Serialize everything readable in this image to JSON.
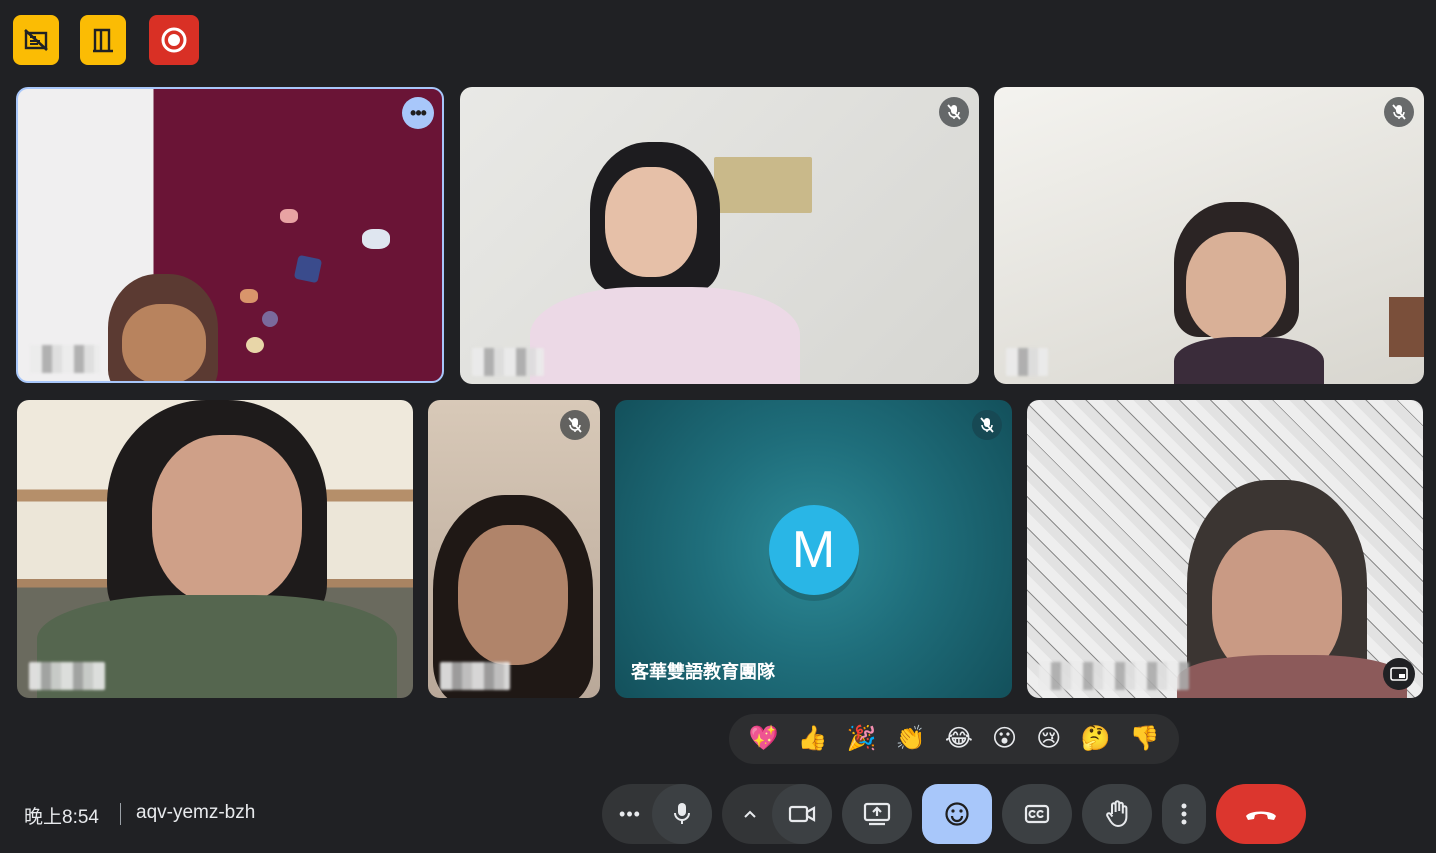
{
  "top_icons": [
    {
      "name": "no-video-icon",
      "color": "#fbbc04"
    },
    {
      "name": "door-icon",
      "color": "#fbbc04"
    },
    {
      "name": "record-icon",
      "color": "#d93025"
    }
  ],
  "tiles": [
    {
      "id": "t1",
      "muted": false,
      "pinned_active": true
    },
    {
      "id": "t2",
      "muted": true
    },
    {
      "id": "t3",
      "muted": true
    },
    {
      "id": "t4",
      "muted": false
    },
    {
      "id": "t5",
      "muted": true
    },
    {
      "id": "t6",
      "muted": true,
      "avatar_letter": "M",
      "name": "客華雙語教育團隊",
      "avatar_color": "#29b6e6"
    },
    {
      "id": "t7",
      "muted": false
    }
  ],
  "reactions": [
    "💖",
    "👍",
    "🎉",
    "👏",
    "😂",
    "😮",
    "😢",
    "🤔",
    "👎"
  ],
  "meeting": {
    "time": "晚上8:54",
    "code": "aqv-yemz-bzh"
  },
  "colors": {
    "accent": "#a8c7fa",
    "end_call": "#dc362e",
    "background": "#202124"
  }
}
